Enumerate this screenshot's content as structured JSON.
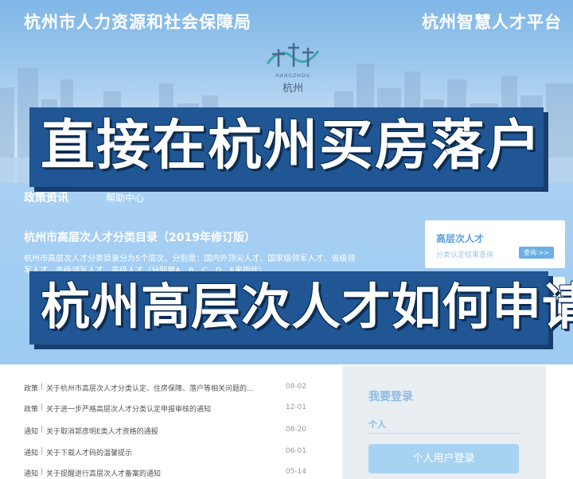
{
  "header": {
    "site_name": "杭州市人力资源和社会保障局",
    "platform_name": "杭州智慧人才平台",
    "logo_subtitle": "HANGZHOU",
    "logo_text": "杭州"
  },
  "nav": {
    "tab1": "政策资讯",
    "tab2": "帮助中心"
  },
  "catalog": {
    "title": "杭州市高层次人才分类目录（2019年修订版）",
    "desc": "杭州市高层次人才分类目录分为5个层次，分别是：国内外顶尖人才、国家级领军人才、省级领军人才、市级领军人才、高级人才（分别用A、B、C、D、E来指代）"
  },
  "side_card": {
    "title": "高层次人才",
    "subtitle": "分类认定结果查询",
    "button": "查询 >>"
  },
  "captions": {
    "top": "直接在杭州买房落户",
    "bottom": "杭州高层次人才如何申请"
  },
  "news": [
    {
      "cat": "政策",
      "title": "关于杭州市高层次人才分类认定、住房保障、落户等相关问题的...",
      "date": "08-02"
    },
    {
      "cat": "政策",
      "title": "关于进一步严格高层次人才分类认定申报审核的通知",
      "date": "12-01"
    },
    {
      "cat": "通知",
      "title": "关于取消郭彦明E类人才资格的通报",
      "date": "08-20"
    },
    {
      "cat": "通知",
      "title": "关于下载人才码的温馨提示",
      "date": "06-01"
    },
    {
      "cat": "通知",
      "title": "关于提醒进行高层次人才备案的通知",
      "date": "05-14"
    }
  ],
  "news_separator": "|",
  "login": {
    "title": "我要登录",
    "tab": "个人",
    "button": "个人用户登录"
  },
  "colors": {
    "caption_bg": "#1f5693",
    "accent": "#5aa0dd"
  }
}
